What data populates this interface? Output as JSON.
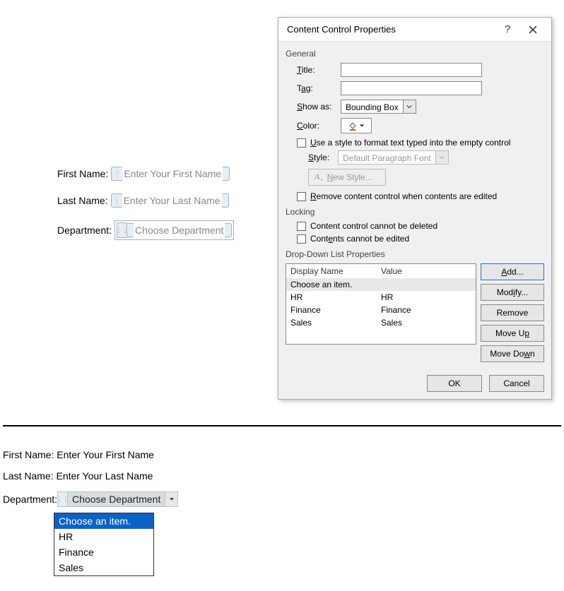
{
  "upperForm": {
    "firstNameLabel": "First Name:",
    "firstNamePlaceholder": "Enter Your First Name",
    "lastNameLabel": "Last Name:",
    "lastNamePlaceholder": "Enter Your Last Name",
    "departmentLabel": "Department:",
    "departmentPlaceholder": "Choose Department"
  },
  "dialog": {
    "title": "Content Control Properties",
    "sections": {
      "general": "General",
      "locking": "Locking",
      "dropdown": "Drop-Down List Properties"
    },
    "labels": {
      "title": "Title:",
      "tag": "Tag:",
      "showAs": "Show as:",
      "color": "Color:",
      "style": "Style:"
    },
    "values": {
      "title": "",
      "tag": "",
      "showAs": "Bounding Box",
      "style": "Default Paragraph Font"
    },
    "checkboxes": {
      "useStyle": "Use a style to format text typed into the empty control",
      "newStyle": "New Style...",
      "removeControl": "Remove content control when contents are edited",
      "cannotDelete": "Content control cannot be deleted",
      "cannotEdit": "Contents cannot be edited"
    },
    "ddlHeaders": {
      "displayName": "Display Name",
      "value": "Value"
    },
    "ddlItems": [
      {
        "name": "Choose an item.",
        "value": ""
      },
      {
        "name": "HR",
        "value": "HR"
      },
      {
        "name": "Finance",
        "value": "Finance"
      },
      {
        "name": "Sales",
        "value": "Sales"
      }
    ],
    "buttons": {
      "add": "Add...",
      "modify": "Modify...",
      "remove": "Remove",
      "moveUp": "Move Up",
      "moveDown": "Move Down",
      "ok": "OK",
      "cancel": "Cancel"
    }
  },
  "lowerForm": {
    "firstNameLabel": "First Name:",
    "firstNameValue": "Enter Your First Name",
    "lastNameLabel": "Last Name:",
    "lastNameValue": "Enter Your Last Name",
    "departmentLabel": "Department:",
    "departmentValue": "Choose Department",
    "options": [
      "Choose an item.",
      "HR",
      "Finance",
      "Sales"
    ]
  }
}
